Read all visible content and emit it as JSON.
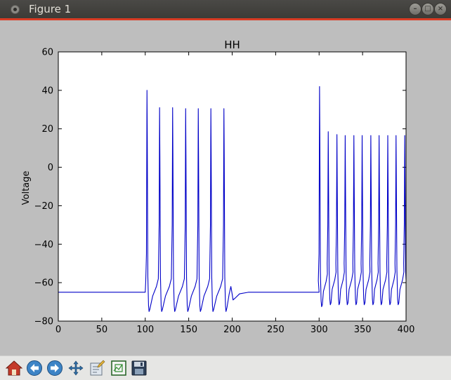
{
  "window": {
    "title": "Figure 1"
  },
  "chart_data": {
    "type": "line",
    "title": "HH",
    "xlabel": "",
    "ylabel": "Voltage",
    "xlim": [
      0,
      400
    ],
    "ylim": [
      -80,
      60
    ],
    "xticks": [
      0,
      50,
      100,
      150,
      200,
      250,
      300,
      350,
      400
    ],
    "yticks": [
      -80,
      -60,
      -40,
      -20,
      0,
      20,
      40,
      60
    ],
    "xtick_labels": [
      "0",
      "50",
      "100",
      "150",
      "200",
      "250",
      "300",
      "350",
      "400"
    ],
    "ytick_labels": [
      "−80",
      "−60",
      "−40",
      "−20",
      "0",
      "20",
      "40",
      "60"
    ],
    "grid": false,
    "series": [
      {
        "color": "#0000c8",
        "rest": -65,
        "phases": [
          {
            "start": 100,
            "end": 200,
            "peaks": [
              [
                102,
                40
              ],
              [
                116.5,
                31
              ],
              [
                131.5,
                31
              ],
              [
                146.5,
                30.5
              ],
              [
                161,
                30.5
              ],
              [
                175.5,
                30.5
              ],
              [
                190.5,
                30.5
              ]
            ],
            "troughs": [
              -75,
              -75,
              -75,
              -75,
              -75,
              -75,
              -75
            ]
          },
          {
            "start": 300,
            "end": 400,
            "peaks": [
              [
                300.5,
                42
              ],
              [
                310.5,
                18.5
              ],
              [
                320.5,
                17
              ],
              [
                330,
                16.5
              ],
              [
                340,
                16.5
              ],
              [
                349.5,
                16.5
              ],
              [
                359.5,
                16.5
              ],
              [
                369,
                16.5
              ],
              [
                379,
                16.5
              ],
              [
                388.5,
                16.5
              ],
              [
                398.5,
                16.5
              ]
            ],
            "troughs": [
              -72.5,
              -71.5,
              -71.5,
              -71.5,
              -71.5,
              -71.5,
              -71.5,
              -71.5,
              -71.5,
              -71.5,
              -71.5
            ]
          }
        ]
      }
    ]
  },
  "toolbar": {
    "buttons": [
      "home",
      "back",
      "forward",
      "pan",
      "configure-subplots",
      "zoom-to-rect",
      "save"
    ]
  },
  "colors": {
    "figure_bg": "#bebebe",
    "line": "#0000c8",
    "titlebar": "#3c3b37",
    "titlebar_accent": "#d83b24"
  }
}
